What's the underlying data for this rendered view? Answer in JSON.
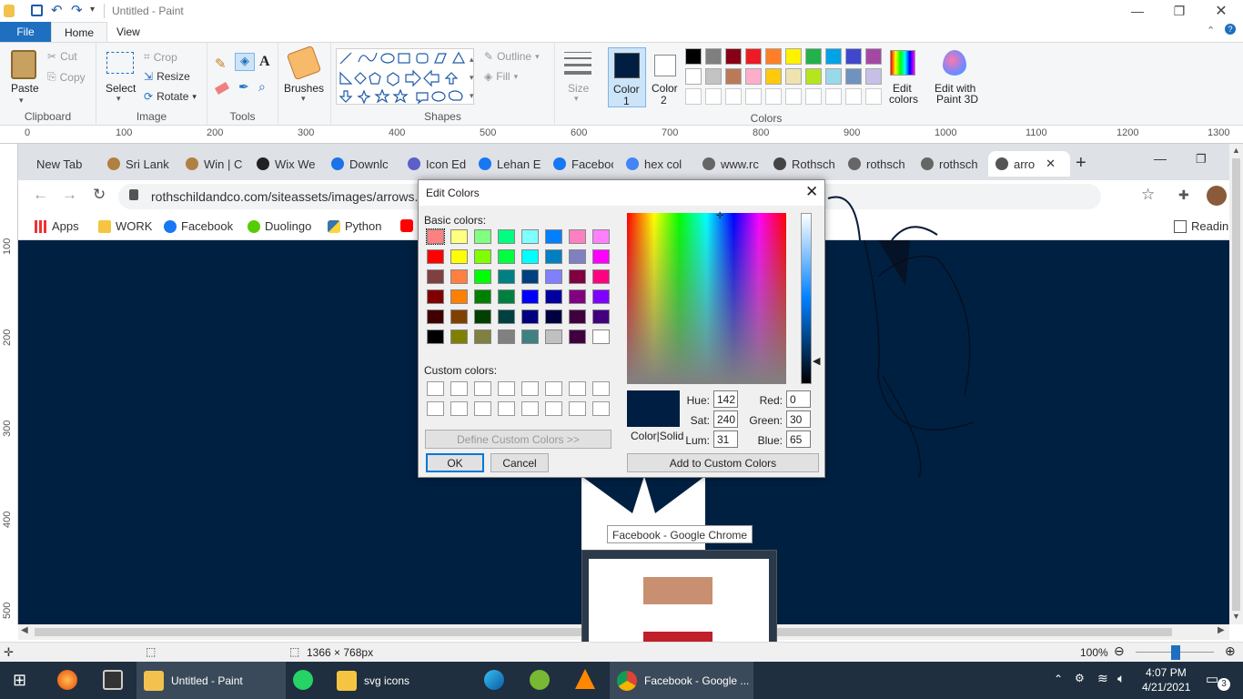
{
  "window": {
    "title": "Untitled - Paint"
  },
  "ribbon": {
    "file_tab": "File",
    "tabs": [
      "Home",
      "View"
    ],
    "clipboard": {
      "paste": "Paste",
      "cut": "Cut",
      "copy": "Copy",
      "label": "Clipboard"
    },
    "image": {
      "select": "Select",
      "crop": "Crop",
      "resize": "Resize",
      "rotate": "Rotate",
      "label": "Image"
    },
    "tools": {
      "label": "Tools"
    },
    "brushes": "Brushes",
    "shapes": {
      "outline": "Outline",
      "fill": "Fill",
      "label": "Shapes"
    },
    "size": "Size",
    "color1": {
      "label": "Color",
      "num": "1",
      "color": "#001e41"
    },
    "color2": {
      "label": "Color",
      "num": "2",
      "color": "#ffffff"
    },
    "colors_label": "Colors",
    "edit_colors": {
      "line1": "Edit",
      "line2": "colors"
    },
    "paint3d": {
      "line1": "Edit with",
      "line2": "Paint 3D"
    },
    "palette_row1": [
      "#000000",
      "#7f7f7f",
      "#880015",
      "#ed1c24",
      "#ff7f27",
      "#fff200",
      "#22b14c",
      "#00a2e8",
      "#3f48cc",
      "#a349a4"
    ],
    "palette_row2": [
      "#ffffff",
      "#c3c3c3",
      "#b97a57",
      "#ffaec9",
      "#ffc90e",
      "#efe4b0",
      "#b5e61d",
      "#99d9ea",
      "#7092be",
      "#c8bfe7"
    ]
  },
  "ruler": {
    "h": [
      "0",
      "100",
      "200",
      "300",
      "400",
      "500",
      "600",
      "700",
      "800",
      "900",
      "1000",
      "1100",
      "1200",
      "1300"
    ],
    "v": [
      "100",
      "200",
      "300",
      "400",
      "500"
    ]
  },
  "chrome": {
    "tabs": [
      "New Tab",
      "Sri Lank",
      "Win | C",
      "Wix We",
      "Downlc",
      "Icon Ed",
      "Lehan E",
      "Faceboo",
      "hex col",
      "www.rc",
      "Rothsch",
      "rothsch",
      "rothsch",
      "arro"
    ],
    "tab_icon_colors": [
      "#dee1e6",
      "#b08040",
      "#b08040",
      "#222222",
      "#1a73e8",
      "#5b5fc7",
      "#1877f2",
      "#1877f2",
      "#4285f4",
      "#666666",
      "#444444",
      "#666666",
      "#666666",
      "#555555"
    ],
    "url": "rothschildandco.com/siteassets/images/arrows.",
    "bookmarks": [
      "Apps",
      "WORK",
      "Facebook",
      "Duolingo",
      "Python"
    ],
    "reading": "Readin"
  },
  "dialog": {
    "title": "Edit Colors",
    "basic_label": "Basic colors:",
    "basic_colors": [
      "#ff8080",
      "#ffff80",
      "#80ff80",
      "#00ff80",
      "#80ffff",
      "#0080ff",
      "#ff80c0",
      "#ff80ff",
      "#ff0000",
      "#ffff00",
      "#80ff00",
      "#00ff40",
      "#00ffff",
      "#0080c0",
      "#8080c0",
      "#ff00ff",
      "#804040",
      "#ff8040",
      "#00ff00",
      "#008080",
      "#004080",
      "#8080ff",
      "#800040",
      "#ff0080",
      "#800000",
      "#ff8000",
      "#008000",
      "#008040",
      "#0000ff",
      "#0000a0",
      "#800080",
      "#8000ff",
      "#400000",
      "#804000",
      "#004000",
      "#004040",
      "#000080",
      "#000040",
      "#400040",
      "#400080",
      "#000000",
      "#808000",
      "#808040",
      "#808080",
      "#408080",
      "#c0c0c0",
      "#400040",
      "#ffffff"
    ],
    "custom_label": "Custom colors:",
    "define_button": "Define Custom Colors >>",
    "ok": "OK",
    "cancel": "Cancel",
    "color_solid": "Color|Solid",
    "hue_label": "Hue:",
    "hue": "142",
    "sat_label": "Sat:",
    "sat": "240",
    "lum_label": "Lum:",
    "lum": "31",
    "red_label": "Red:",
    "red": "0",
    "green_label": "Green:",
    "green": "30",
    "blue_label": "Blue:",
    "blue": "65",
    "add_custom": "Add to Custom Colors",
    "preview_color": "#001e41"
  },
  "status": {
    "dimensions": "1366 × 768px",
    "zoom": "100%"
  },
  "tooltip": "Facebook - Google Chrome",
  "taskbar": {
    "paint": "Untitled - Paint",
    "folder": "svg icons",
    "chrome": "Facebook - Google ...",
    "time": "4:07 PM",
    "date": "4/21/2021",
    "notif": "3"
  }
}
